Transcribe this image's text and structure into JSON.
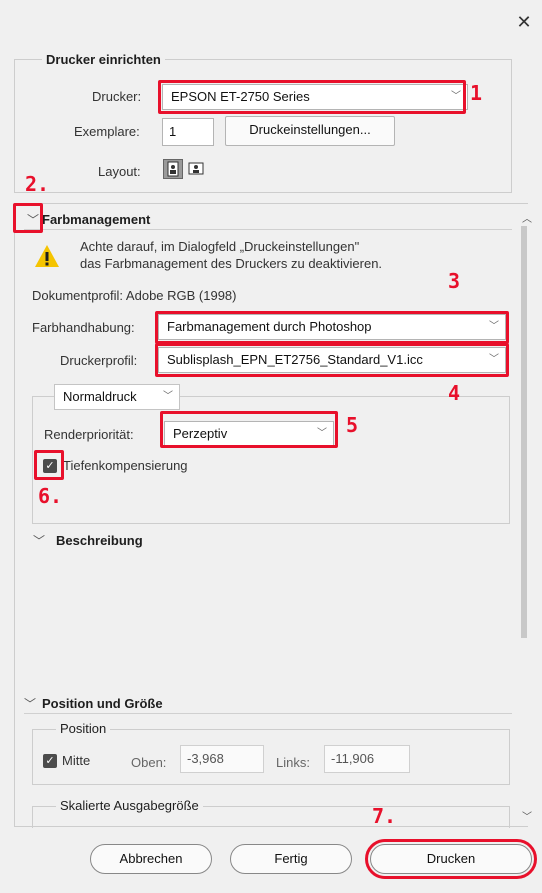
{
  "close_icon": "✕",
  "printer_setup": {
    "legend": "Drucker einrichten",
    "printer_label": "Drucker:",
    "printer_value": "EPSON ET-2750 Series",
    "copies_label": "Exemplare:",
    "copies_value": "1",
    "print_settings_button": "Druckeinstellungen...",
    "layout_label": "Layout:"
  },
  "color_management": {
    "title": "Farbmanagement",
    "warning_line1": "Achte darauf, im Dialogfeld „Druckeinstellungen\"",
    "warning_line2": "das Farbmanagement des Druckers zu deaktivieren.",
    "document_profile": "Dokumentprofil: Adobe RGB (1998)",
    "color_handling_label": "Farbhandhabung:",
    "color_handling_value": "Farbmanagement durch Photoshop",
    "printer_profile_label": "Druckerprofil:",
    "printer_profile_value": "Sublisplash_EPN_ET2756_Standard_V1.icc",
    "print_mode_value": "Normaldruck",
    "rendering_intent_label": "Renderpriorität:",
    "rendering_intent_value": "Perzeptiv",
    "black_point_label": "Tiefenkompensierung",
    "black_point_checked": true
  },
  "description": {
    "title": "Beschreibung"
  },
  "position_size": {
    "title": "Position und Größe",
    "position_legend": "Position",
    "center_label": "Mitte",
    "top_label": "Oben:",
    "top_value": "-3,968",
    "left_label": "Links:",
    "left_value": "-11,906",
    "scaled_legend": "Skalierte Ausgabegröße"
  },
  "footer": {
    "cancel": "Abbrechen",
    "done": "Fertig",
    "print": "Drucken"
  },
  "annotations": {
    "m1": "1",
    "m2": "2.",
    "m3": "3",
    "m4": "4",
    "m5": "5",
    "m6": "6.",
    "m7": "7."
  },
  "colors": {
    "annotation_red": "#e8102b",
    "warning_yellow": "#f5c400",
    "background": "#f0f0f0"
  }
}
